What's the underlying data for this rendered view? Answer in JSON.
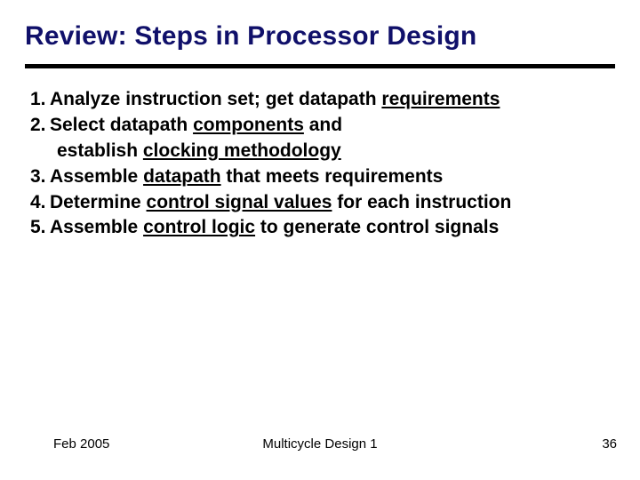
{
  "title": "Review: Steps in Processor Design",
  "items": [
    {
      "num": "1.",
      "pre": "Analyze instruction set; get datapath ",
      "u": "requirements",
      "post": ""
    },
    {
      "num": "2.",
      "pre": "Select datapath ",
      "u": "components",
      "post": " and"
    },
    {
      "num": "",
      "pre": "establish ",
      "u": "clocking methodology",
      "post": "",
      "cont": true
    },
    {
      "num": "3.",
      "pre": "Assemble ",
      "u": "datapath",
      "post": " that meets requirements"
    },
    {
      "num": "4.",
      "pre": "Determine ",
      "u": "control signal values",
      "post": " for each instruction"
    },
    {
      "num": "5.",
      "pre": "Assemble ",
      "u": "control logic",
      "post": " to generate control signals"
    }
  ],
  "footer": {
    "left": "Feb 2005",
    "center": "Multicycle Design 1",
    "right": "36"
  }
}
